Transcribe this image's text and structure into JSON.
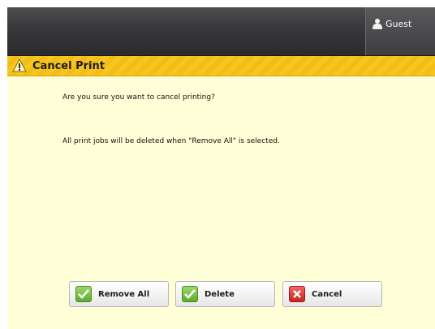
{
  "header": {
    "user_label": "Guest",
    "user_icon": "user-icon"
  },
  "dialog": {
    "title": "Cancel Print",
    "title_icon": "warning-icon",
    "message_primary": "Are you sure you want to cancel printing?",
    "message_secondary": "All print jobs will be deleted when \"Remove All\" is selected."
  },
  "buttons": {
    "remove_all": {
      "label": "Remove All",
      "icon": "check-icon"
    },
    "delete": {
      "label": "Delete",
      "icon": "check-icon"
    },
    "cancel": {
      "label": "Cancel",
      "icon": "x-icon"
    }
  },
  "colors": {
    "background": "#ffffd7",
    "title_bar": "#f7c520",
    "header": "#38383a",
    "confirm_icon": "#5faa2c",
    "cancel_icon": "#c8241f"
  }
}
